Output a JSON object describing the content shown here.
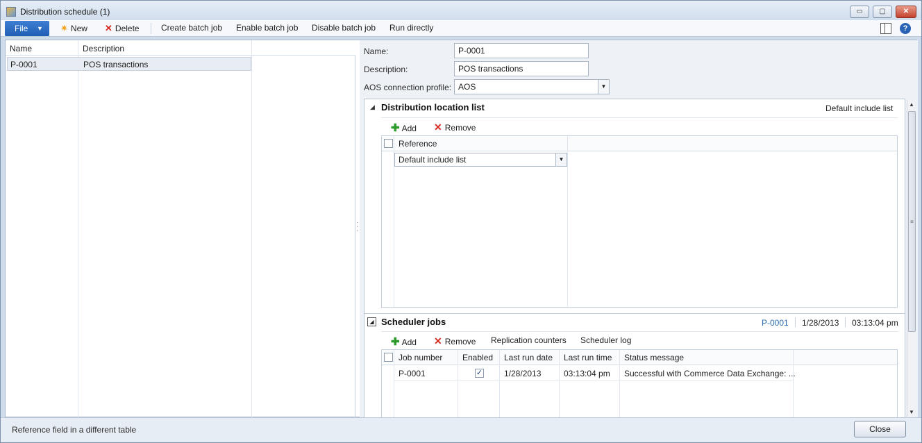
{
  "window": {
    "title": "Distribution schedule (1)",
    "min": "▭",
    "max": "▢",
    "close": "✕"
  },
  "toolbar": {
    "file_label": "File",
    "new_label": "New",
    "delete_label": "Delete",
    "create_batch_label": "Create batch job",
    "enable_batch_label": "Enable batch job",
    "disable_batch_label": "Disable batch job",
    "run_directly_label": "Run directly",
    "help_glyph": "?"
  },
  "left_grid": {
    "columns": [
      "Name",
      "Description"
    ],
    "rows": [
      {
        "name": "P-0001",
        "description": "POS transactions"
      }
    ]
  },
  "form": {
    "name_label": "Name:",
    "name_value": "P-0001",
    "description_label": "Description:",
    "description_value": "POS transactions",
    "aos_label": "AOS connection profile:",
    "aos_value": "AOS"
  },
  "distribution": {
    "title": "Distribution location list",
    "summary": "Default include list",
    "add_label": "Add",
    "remove_label": "Remove",
    "column_reference": "Reference",
    "row_value": "Default include list"
  },
  "scheduler": {
    "title": "Scheduler jobs",
    "summary_job": "P-0001",
    "summary_date": "1/28/2013",
    "summary_time": "03:13:04 pm",
    "add_label": "Add",
    "remove_label": "Remove",
    "replication_label": "Replication counters",
    "log_label": "Scheduler log",
    "columns": [
      "Job number",
      "Enabled",
      "Last run date",
      "Last run time",
      "Status message"
    ],
    "rows": [
      {
        "job_number": "P-0001",
        "enabled": true,
        "last_run_date": "1/28/2013",
        "last_run_time": "03:13:04 pm",
        "status": "Successful with Commerce Data Exchange: ..."
      }
    ]
  },
  "status": {
    "text": "Reference field in a different table",
    "close_label": "Close"
  }
}
